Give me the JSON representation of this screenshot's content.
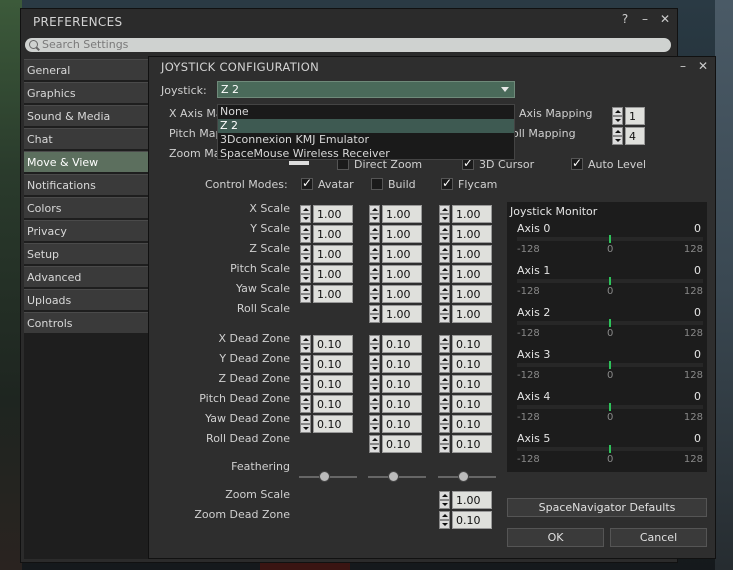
{
  "preferences": {
    "title": "PREFERENCES",
    "search_placeholder": "Search Settings",
    "sidebar": [
      {
        "label": "General"
      },
      {
        "label": "Graphics"
      },
      {
        "label": "Sound & Media"
      },
      {
        "label": "Chat"
      },
      {
        "label": "Move & View",
        "active": true
      },
      {
        "label": "Notifications"
      },
      {
        "label": "Colors"
      },
      {
        "label": "Privacy"
      },
      {
        "label": "Setup"
      },
      {
        "label": "Advanced"
      },
      {
        "label": "Uploads"
      },
      {
        "label": "Controls"
      }
    ]
  },
  "joystick": {
    "title": "JOYSTICK CONFIGURATION",
    "joystick_label": "Joystick:",
    "joystick_value": "Z 2",
    "dropdown_options": [
      "None",
      "Z 2",
      "3Dconnexion KMJ Emulator",
      "SpaceMouse Wireless Receiver"
    ],
    "x_axis_label": "X Axis Ma",
    "pitch_label": "Pitch Map",
    "zoom_label": "Zoom Ma",
    "axis_mapping_label": "Axis Mapping",
    "roll_mapping_label": "oll Mapping",
    "axis_mapping_value": "1",
    "roll_mapping_value": "4",
    "direct_zoom_label": "Direct Zoom",
    "cursor_3d_label": "3D Cursor",
    "auto_level_label": "Auto Level",
    "control_modes_label": "Control Modes:",
    "mode_avatar": "Avatar",
    "mode_build": "Build",
    "mode_flycam": "Flycam",
    "scale_labels": [
      "X Scale",
      "Y Scale",
      "Z Scale",
      "Pitch Scale",
      "Yaw Scale",
      "Roll Scale"
    ],
    "avatar_scales": [
      "1.00",
      "1.00",
      "1.00",
      "1.00",
      "1.00"
    ],
    "build_scales": [
      "1.00",
      "1.00",
      "1.00",
      "1.00",
      "1.00",
      "1.00"
    ],
    "flycam_scales": [
      "1.00",
      "1.00",
      "1.00",
      "1.00",
      "1.00",
      "1.00"
    ],
    "dead_labels": [
      "X Dead Zone",
      "Y Dead Zone",
      "Z Dead Zone",
      "Pitch Dead Zone",
      "Yaw Dead Zone",
      "Roll Dead Zone"
    ],
    "avatar_dead": [
      "0.10",
      "0.10",
      "0.10",
      "0.10",
      "0.10"
    ],
    "build_dead": [
      "0.10",
      "0.10",
      "0.10",
      "0.10",
      "0.10",
      "0.10"
    ],
    "flycam_dead": [
      "0.10",
      "0.10",
      "0.10",
      "0.10",
      "0.10",
      "0.10"
    ],
    "feathering_label": "Feathering",
    "zoom_scale_label": "Zoom Scale",
    "zoom_dead_label": "Zoom Dead Zone",
    "zoom_scale_value": "1.00",
    "zoom_dead_value": "0.10",
    "monitor_title": "Joystick Monitor",
    "axes": [
      {
        "name": "Axis 0",
        "value": "0"
      },
      {
        "name": "Axis 1",
        "value": "0"
      },
      {
        "name": "Axis 2",
        "value": "0"
      },
      {
        "name": "Axis 3",
        "value": "0"
      },
      {
        "name": "Axis 4",
        "value": "0"
      },
      {
        "name": "Axis 5",
        "value": "0"
      }
    ],
    "axis_min": "-128",
    "axis_mid": "0",
    "axis_max": "128",
    "spacenav_button": "SpaceNavigator Defaults",
    "ok_button": "OK",
    "cancel_button": "Cancel"
  }
}
